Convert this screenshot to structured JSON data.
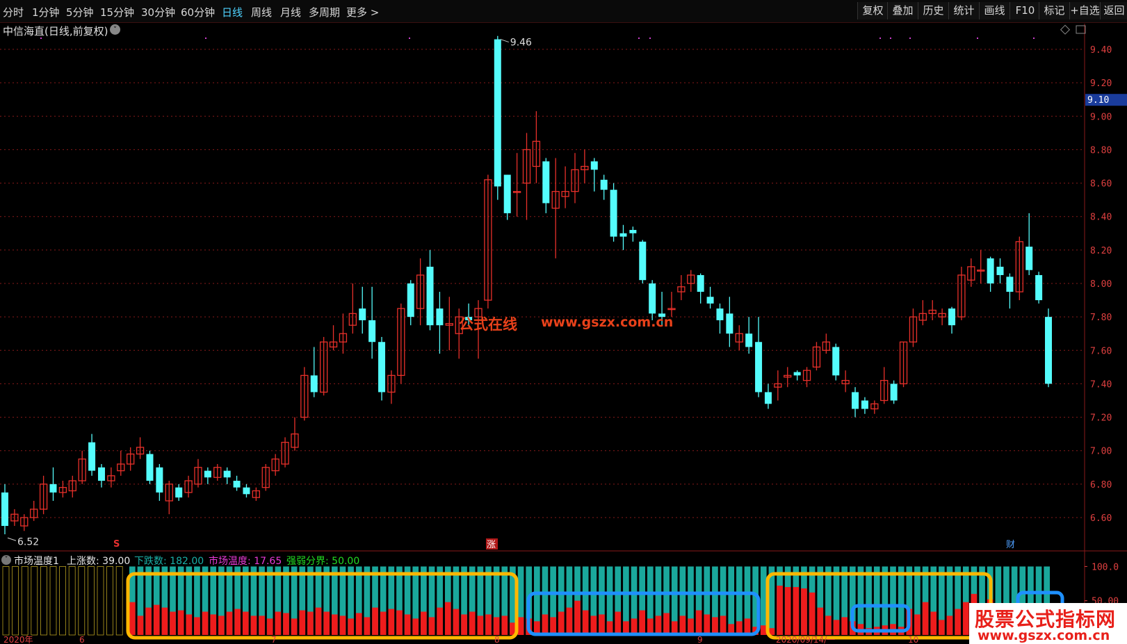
{
  "tabs": [
    "分时",
    "1分钟",
    "5分钟",
    "15分钟",
    "30分钟",
    "60分钟",
    "日线",
    "周线",
    "月线",
    "多周期",
    "更多 >"
  ],
  "active_tab": "日线",
  "right_buttons": [
    "复权",
    "叠加",
    "历史",
    "统计",
    "画线",
    "F10",
    "标记",
    "+自选",
    "返回"
  ],
  "chart_title": "中信海直(日线,前复权)",
  "price_axis": [
    "9.40",
    "9.20",
    "9.00",
    "8.80",
    "8.60",
    "8.40",
    "8.20",
    "8.00",
    "7.80",
    "7.60",
    "7.40",
    "7.20",
    "7.00",
    "6.80",
    "6.60"
  ],
  "current_price_tag": "9.10",
  "high_label": "9.46",
  "low_label": "6.52",
  "watermark_cn": "公式在线",
  "watermark_url": "www.gszx.com.cn",
  "markers": {
    "s": "S",
    "zhang": "涨",
    "cai": "财"
  },
  "indicator": {
    "name": "市场温度1",
    "up_label": "上涨数: 39.00",
    "down_label": "下跌数: 182.00",
    "temp_label": "市场温度: 17.65",
    "split_label": "强弱分界: 50.00"
  },
  "indicator_axis": [
    "100.0",
    "50.00"
  ],
  "date_labels": [
    "2020年",
    "6",
    "7",
    "8",
    "9",
    "2020/09/14/一",
    "10"
  ],
  "logo": {
    "line1": "股票公式指标网",
    "line2": "www.gszx.com.cn"
  },
  "colors": {
    "up": "#e8302a",
    "down": "#54fcfc",
    "grid": "#8a1a1a",
    "highlight_orange": "#ffb800",
    "highlight_blue": "#1e90ff"
  },
  "chart_data": {
    "type": "candlestick",
    "ylim": [
      6.5,
      9.5
    ],
    "candles": [
      [
        6.75,
        6.55,
        6.8,
        6.5
      ],
      [
        6.58,
        6.62,
        6.65,
        6.55
      ],
      [
        6.55,
        6.6,
        6.62,
        6.52
      ],
      [
        6.6,
        6.65,
        6.7,
        6.58
      ],
      [
        6.65,
        6.8,
        6.85,
        6.62
      ],
      [
        6.8,
        6.75,
        6.9,
        6.7
      ],
      [
        6.75,
        6.78,
        6.82,
        6.72
      ],
      [
        6.76,
        6.82,
        6.85,
        6.72
      ],
      [
        6.82,
        6.95,
        7.0,
        6.8
      ],
      [
        7.05,
        6.88,
        7.1,
        6.85
      ],
      [
        6.9,
        6.82,
        6.92,
        6.78
      ],
      [
        6.82,
        6.85,
        6.9,
        6.78
      ],
      [
        6.88,
        6.92,
        7.0,
        6.85
      ],
      [
        6.92,
        6.98,
        7.02,
        6.88
      ],
      [
        6.98,
        7.02,
        7.08,
        6.95
      ],
      [
        6.98,
        6.82,
        7.0,
        6.8
      ],
      [
        6.9,
        6.75,
        6.92,
        6.7
      ],
      [
        6.7,
        6.8,
        6.82,
        6.62
      ],
      [
        6.78,
        6.72,
        6.8,
        6.7
      ],
      [
        6.75,
        6.82,
        6.85,
        6.72
      ],
      [
        6.8,
        6.9,
        6.95,
        6.78
      ],
      [
        6.88,
        6.84,
        6.9,
        6.8
      ],
      [
        6.84,
        6.9,
        6.92,
        6.82
      ],
      [
        6.88,
        6.84,
        6.9,
        6.8
      ],
      [
        6.82,
        6.78,
        6.85,
        6.76
      ],
      [
        6.78,
        6.74,
        6.8,
        6.72
      ],
      [
        6.72,
        6.76,
        6.78,
        6.7
      ],
      [
        6.78,
        6.9,
        6.92,
        6.76
      ],
      [
        6.88,
        6.95,
        6.98,
        6.85
      ],
      [
        6.92,
        7.05,
        7.08,
        6.9
      ],
      [
        7.02,
        7.1,
        7.2,
        7.0
      ],
      [
        7.2,
        7.45,
        7.5,
        7.18
      ],
      [
        7.45,
        7.35,
        7.62,
        7.32
      ],
      [
        7.35,
        7.65,
        7.68,
        7.33
      ],
      [
        7.62,
        7.65,
        7.75,
        7.6
      ],
      [
        7.65,
        7.7,
        7.82,
        7.58
      ],
      [
        7.75,
        7.82,
        8.0,
        7.7
      ],
      [
        7.85,
        7.78,
        7.98,
        7.7
      ],
      [
        7.78,
        7.65,
        7.98,
        7.55
      ],
      [
        7.65,
        7.35,
        7.68,
        7.3
      ],
      [
        7.35,
        7.45,
        7.48,
        7.28
      ],
      [
        7.45,
        7.85,
        7.88,
        7.4
      ],
      [
        8.0,
        7.8,
        8.02,
        7.75
      ],
      [
        7.85,
        8.05,
        8.15,
        7.75
      ],
      [
        8.1,
        7.75,
        8.2,
        7.72
      ],
      [
        7.85,
        7.75,
        7.95,
        7.58
      ],
      [
        7.75,
        7.76,
        7.92,
        7.6
      ],
      [
        7.7,
        7.8,
        7.85,
        7.55
      ],
      [
        7.8,
        7.78,
        7.88,
        7.75
      ],
      [
        7.8,
        7.85,
        7.9,
        7.55
      ],
      [
        7.9,
        8.62,
        8.65,
        7.85
      ],
      [
        9.46,
        8.58,
        9.48,
        8.5
      ],
      [
        8.65,
        8.42,
        8.65,
        8.38
      ],
      [
        8.55,
        8.55,
        8.78,
        8.4
      ],
      [
        8.6,
        8.8,
        8.9,
        8.38
      ],
      [
        8.7,
        8.85,
        9.03,
        8.6
      ],
      [
        8.73,
        8.48,
        8.75,
        8.42
      ],
      [
        8.45,
        8.55,
        8.75,
        8.15
      ],
      [
        8.52,
        8.55,
        8.7,
        8.45
      ],
      [
        8.55,
        8.68,
        8.78,
        8.48
      ],
      [
        8.68,
        8.7,
        8.8,
        8.6
      ],
      [
        8.73,
        8.68,
        8.75,
        8.55
      ],
      [
        8.62,
        8.56,
        8.65,
        8.5
      ],
      [
        8.56,
        8.28,
        8.6,
        8.25
      ],
      [
        8.3,
        8.28,
        8.35,
        8.2
      ],
      [
        8.32,
        8.3,
        8.34,
        8.25
      ],
      [
        8.25,
        8.02,
        8.26,
        8.0
      ],
      [
        8.0,
        7.82,
        8.02,
        7.78
      ],
      [
        7.82,
        7.8,
        7.95,
        7.75
      ],
      [
        7.85,
        7.85,
        7.95,
        7.8
      ],
      [
        7.95,
        7.98,
        8.05,
        7.9
      ],
      [
        8.0,
        8.05,
        8.08,
        7.95
      ],
      [
        8.05,
        7.95,
        8.06,
        7.88
      ],
      [
        7.92,
        7.88,
        7.98,
        7.85
      ],
      [
        7.85,
        7.78,
        7.88,
        7.7
      ],
      [
        7.82,
        7.7,
        7.92,
        7.62
      ],
      [
        7.65,
        7.7,
        7.75,
        7.6
      ],
      [
        7.7,
        7.62,
        7.8,
        7.58
      ],
      [
        7.65,
        7.35,
        7.8,
        7.32
      ],
      [
        7.35,
        7.28,
        7.4,
        7.25
      ],
      [
        7.38,
        7.4,
        7.48,
        7.3
      ],
      [
        7.44,
        7.45,
        7.5,
        7.38
      ],
      [
        7.47,
        7.45,
        7.48,
        7.42
      ],
      [
        7.42,
        7.48,
        7.5,
        7.38
      ],
      [
        7.5,
        7.62,
        7.65,
        7.48
      ],
      [
        7.6,
        7.65,
        7.7,
        7.58
      ],
      [
        7.62,
        7.45,
        7.64,
        7.42
      ],
      [
        7.4,
        7.42,
        7.48,
        7.35
      ],
      [
        7.35,
        7.25,
        7.38,
        7.2
      ],
      [
        7.3,
        7.25,
        7.32,
        7.22
      ],
      [
        7.25,
        7.28,
        7.3,
        7.22
      ],
      [
        7.3,
        7.42,
        7.5,
        7.28
      ],
      [
        7.4,
        7.3,
        7.42,
        7.28
      ],
      [
        7.4,
        7.65,
        7.65,
        7.38
      ],
      [
        7.65,
        7.8,
        7.85,
        7.62
      ],
      [
        7.78,
        7.82,
        7.9,
        7.75
      ],
      [
        7.82,
        7.84,
        7.9,
        7.78
      ],
      [
        7.8,
        7.82,
        7.85,
        7.75
      ],
      [
        7.85,
        7.75,
        7.86,
        7.7
      ],
      [
        7.8,
        8.05,
        8.1,
        7.78
      ],
      [
        8.02,
        8.1,
        8.15,
        7.98
      ],
      [
        8.08,
        8.08,
        8.2,
        8.0
      ],
      [
        8.15,
        8.0,
        8.16,
        7.95
      ],
      [
        8.1,
        8.05,
        8.15,
        8.0
      ],
      [
        8.04,
        7.95,
        8.06,
        7.85
      ],
      [
        7.95,
        8.25,
        8.28,
        7.9
      ],
      [
        8.22,
        8.08,
        8.42,
        8.05
      ],
      [
        8.05,
        7.9,
        8.07,
        7.88
      ],
      [
        7.8,
        7.4,
        7.85,
        7.38
      ]
    ]
  },
  "indicator_data": {
    "ylim": [
      0,
      100
    ],
    "up_values": [
      48,
      28,
      40,
      44,
      40,
      34,
      36,
      30,
      26,
      34,
      30,
      28,
      34,
      38,
      34,
      28,
      28,
      24,
      34,
      32,
      24,
      36,
      34,
      40,
      34,
      30,
      28,
      24,
      32,
      26,
      40,
      34,
      38,
      36,
      30,
      24,
      34,
      26,
      40,
      48,
      38,
      30,
      34,
      28,
      30,
      26,
      28,
      18,
      26,
      24,
      20,
      30,
      26,
      34,
      40,
      50,
      36,
      28,
      30,
      20,
      34,
      20,
      24,
      36,
      24,
      28,
      32,
      20,
      28,
      24,
      36,
      30,
      26,
      28,
      16,
      20,
      24,
      12,
      14,
      10,
      72,
      70,
      70,
      68,
      62,
      40,
      28,
      22,
      26,
      20,
      16,
      10,
      12,
      14,
      16,
      12,
      38,
      30,
      48,
      34,
      22,
      28,
      38,
      48,
      60,
      42,
      52,
      38,
      36,
      16,
      12,
      14,
      18,
      20
    ]
  }
}
